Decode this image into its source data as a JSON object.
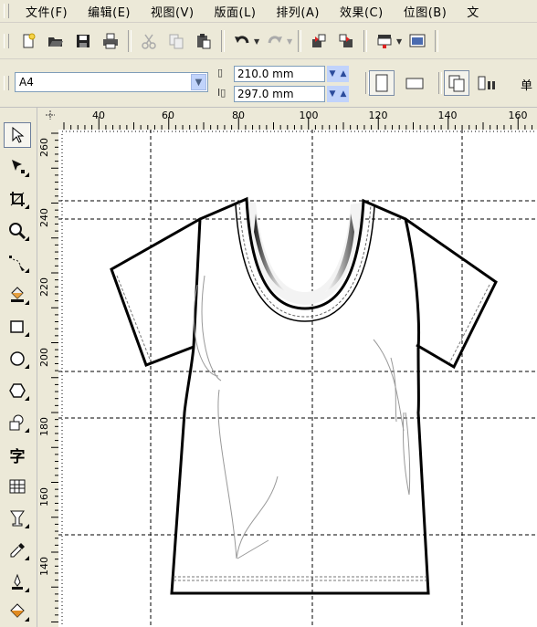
{
  "menu": [
    {
      "label": "文件(F)"
    },
    {
      "label": "编辑(E)"
    },
    {
      "label": "视图(V)"
    },
    {
      "label": "版面(L)"
    },
    {
      "label": "排列(A)"
    },
    {
      "label": "效果(C)"
    },
    {
      "label": "位图(B)"
    },
    {
      "label": "文"
    }
  ],
  "toolbar": {
    "icons": [
      "new-document-icon",
      "open-folder-icon",
      "save-icon",
      "print-icon",
      "cut-icon",
      "copy-icon",
      "paste-icon",
      "undo-icon",
      "redo-icon",
      "import-icon",
      "export-icon",
      "application-launcher-icon",
      "welcome-screen-icon"
    ]
  },
  "property_bar": {
    "paper_size": "A4",
    "width_value": "210.0 mm",
    "height_value": "297.0 mm",
    "right_label": "单"
  },
  "ruler": {
    "horizontal_labels": [
      "40",
      "60",
      "80",
      "100",
      "120",
      "140",
      "160"
    ],
    "vertical_labels": [
      "260",
      "240",
      "220",
      "200",
      "180",
      "160",
      "140"
    ]
  },
  "toolbox": {
    "tools": [
      "pick-tool-icon",
      "shape-tool-icon",
      "crop-tool-icon",
      "zoom-tool-icon",
      "freehand-tool-icon",
      "smart-fill-tool-icon",
      "rectangle-tool-icon",
      "ellipse-tool-icon",
      "polygon-tool-icon",
      "basic-shapes-tool-icon",
      "text-tool-icon",
      "table-tool-icon",
      "interactive-blend-tool-icon",
      "eyedropper-tool-icon",
      "outline-tool-icon",
      "fill-tool-icon"
    ],
    "text_tool_label": "字"
  }
}
